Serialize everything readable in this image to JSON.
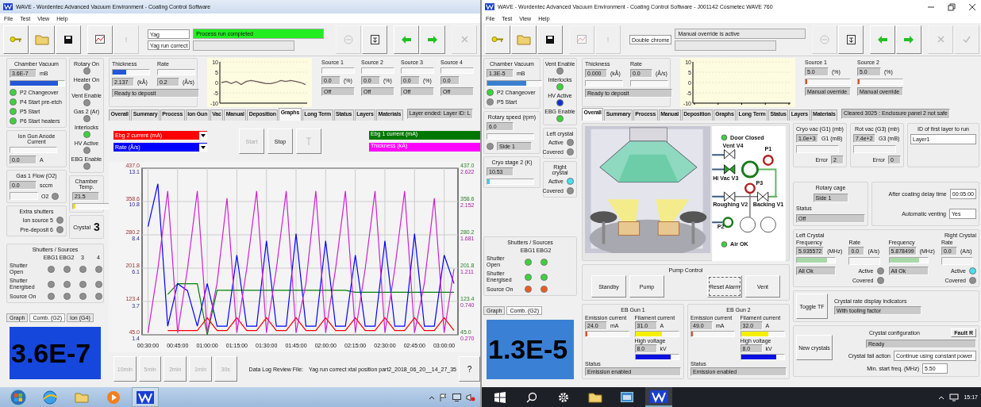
{
  "windows": [
    {
      "title": "WAVE - Wordentec Advanced Vacuum Environment - Coating Control Software",
      "menu": [
        "File",
        "Test",
        "View",
        "Help"
      ],
      "toolbar": [
        {
          "kind": "key",
          "disabled": false
        },
        {
          "kind": "folder",
          "disabled": false
        },
        {
          "kind": "save",
          "disabled": false
        },
        {
          "kind": "chart",
          "disabled": false
        },
        {
          "kind": "text",
          "label": "!",
          "disabled": true
        },
        {
          "kind": "recipe",
          "lines": [
            "Yag",
            "Yag run correct"
          ]
        },
        {
          "kind": "messages",
          "lines": [
            {
              "text": "Process run completed",
              "highlight": true
            }
          ]
        },
        {
          "kind": "circle",
          "disabled": true
        },
        {
          "kind": "doc",
          "disabled": false
        },
        {
          "kind": "back",
          "disabled": false
        },
        {
          "kind": "forward",
          "disabled": false
        },
        {
          "kind": "cross",
          "disabled": true
        }
      ],
      "side": {
        "columns": [
          [
            {
              "title": "Chamber Vacuum",
              "rows": [
                {
                  "kind": "field",
                  "value": "3.6E-7",
                  "unit": "mB"
                },
                {
                  "kind": "bar",
                  "level": 0.88,
                  "color": "#2457d6"
                },
                {
                  "kind": "led",
                  "label": "P2 Changeover",
                  "color": "#3ad43a"
                },
                {
                  "kind": "led",
                  "label": "P4 Start pre-etch",
                  "color": "#3ad43a"
                },
                {
                  "kind": "led",
                  "label": "P5 Start",
                  "color": "#3ad43a"
                },
                {
                  "kind": "led",
                  "label": "P6 Start heaters",
                  "color": "#3ad43a"
                }
              ]
            },
            {
              "title": "Ion Gun Anode Current",
              "rows": [
                {
                  "kind": "bar"
                },
                {
                  "kind": "field",
                  "value": "0.0",
                  "unit": "A"
                }
              ]
            },
            {
              "title": "Gas 1 Flow (O2)",
              "rows": [
                {
                  "kind": "field",
                  "value": "0.0",
                  "unit": "sccm"
                },
                {
                  "kind": "blank-led",
                  "label": "O2",
                  "color": "#8f8f8f"
                }
              ]
            },
            {
              "title": "Extra shutters",
              "rows": [
                {
                  "kind": "labelled-led",
                  "label": "Ion source 5",
                  "color": "#8f8f8f"
                },
                {
                  "kind": "labelled-led",
                  "label": "Pre-deposit 6",
                  "color": "#8f8f8f"
                }
              ]
            }
          ],
          [
            {
              "rows": [
                {
                  "kind": "stacked-led",
                  "label": "Rotary On",
                  "color": "#8f8f8f"
                },
                {
                  "kind": "stacked-led",
                  "label": "Heater On",
                  "color": "#8f8f8f"
                },
                {
                  "kind": "stacked-led",
                  "label": "Vent Enable",
                  "color": "#8f8f8f"
                },
                {
                  "kind": "stacked-led",
                  "label": "Gas 2 (Ar)",
                  "color": "#8f8f8f"
                },
                {
                  "kind": "stacked-led",
                  "label": "Interlocks",
                  "color": "#3ad43a"
                },
                {
                  "kind": "stacked-led",
                  "label": "HV Active",
                  "color": "#8f8f8f"
                },
                {
                  "kind": "stacked-led",
                  "label": "EBG Enable",
                  "color": "#8f8f8f"
                }
              ]
            },
            {
              "title": "Chamber Temp.",
              "rows": [
                {
                  "kind": "field",
                  "value": "21.5"
                },
                {
                  "kind": "bar",
                  "level": 0.06,
                  "color": "#f2e200"
                }
              ]
            },
            {
              "rows": [
                {
                  "kind": "crystal",
                  "label": "Crystal",
                  "value": "3"
                }
              ]
            }
          ]
        ],
        "shutters": {
          "title": "Shutters / Sources",
          "columns": [
            "EBG1",
            "EBG2",
            "3",
            "4"
          ],
          "rows": [
            {
              "label": "Shutter Open",
              "leds": [
                {
                  "color": "#8f8f8f"
                },
                {
                  "color": "#8f8f8f"
                },
                {
                  "color": "#8f8f8f"
                },
                {
                  "color": "#8f8f8f"
                }
              ]
            },
            {
              "label": "Shutter Energised",
              "leds": [
                {
                  "color": "#8f8f8f"
                },
                {
                  "color": "#8f8f8f"
                },
                {
                  "color": "#8f8f8f"
                },
                {
                  "color": "#8f8f8f"
                }
              ]
            },
            {
              "label": "Source On",
              "leds": [
                {
                  "color": "#8f8f8f"
                },
                {
                  "color": "#8f8f8f"
                },
                {
                  "color": "#8f8f8f"
                },
                {
                  "color": "#8f8f8f"
                }
              ]
            }
          ]
        },
        "display": {
          "tabs": [
            {
              "label": "Graph",
              "selected": false
            },
            {
              "label": "Comb. (G2)",
              "selected": true
            },
            {
              "label": "Ion (G4)",
              "selected": false
            }
          ],
          "value": "3.6E-7",
          "color": "#1547dc"
        }
      },
      "main": {
        "deposition": {
          "thickness": {
            "label": "Thickness",
            "value": "2.137",
            "unit": "(kÅ)",
            "level": 0.36
          },
          "rate": {
            "label": "Rate",
            "value": "0.2",
            "unit": "(Å/s)"
          },
          "status": "Ready to deposit"
        },
        "mini_chart": {
          "chart_data": {
            "type": "line",
            "grid": true,
            "ylim": [
              -10,
              10
            ],
            "yticks": [
              10,
              5,
              0,
              -5,
              -10
            ],
            "series": [
              {
                "color": "#6a5a5a",
                "values": [
                  0,
                  0.5,
                  -0.5,
                  0.5,
                  -1,
                  0.5,
                  1,
                  0.5,
                  0,
                  -0.5,
                  -0.5,
                  0,
                  1,
                  0.5,
                  1,
                  0.5,
                  0,
                  -1
                ]
              }
            ]
          }
        },
        "sources": [
          {
            "label": "Source 1",
            "value": "0.0",
            "unit": "(%)",
            "mode": "Off"
          },
          {
            "label": "Source 2",
            "value": "0.0",
            "unit": "(%)",
            "mode": "Off"
          },
          {
            "label": "Source 3",
            "value": "0.0",
            "unit": "(%)",
            "mode": "Off"
          },
          {
            "label": "Source 4",
            "value": "0.0",
            "mode": "Off"
          }
        ],
        "tabs": [
          {
            "label": "Overall",
            "selected": false
          },
          {
            "label": "Summary",
            "selected": false
          },
          {
            "label": "Process",
            "selected": false
          },
          {
            "label": "Ion Gun",
            "selected": false
          },
          {
            "label": "Vac",
            "selected": false
          },
          {
            "label": "Manual",
            "selected": false
          },
          {
            "label": "Deposition",
            "selected": false
          },
          {
            "label": "Graphs",
            "selected": true
          },
          {
            "label": "Long Term",
            "selected": false
          },
          {
            "label": "Status",
            "selected": false
          },
          {
            "label": "Layers",
            "selected": false
          },
          {
            "label": "Materials",
            "selected": false
          }
        ],
        "tab_message": "Layer ended: Layer ID: L",
        "graphs": {
          "selectors": [
            {
              "kind": "dropdown",
              "label": "Ebg 2 current (mA)",
              "color": "#ff0000"
            },
            {
              "kind": "dropdown",
              "label": "Rate (Å/s)",
              "color": "#0000ff"
            },
            {
              "kind": "swatch",
              "label": "Ebg 1 current (mA)",
              "color": "#007800"
            },
            {
              "kind": "swatch",
              "label": "Thickness (kÅ)",
              "color": "#ff00ff"
            }
          ],
          "buttons": [
            {
              "kind": "text",
              "label": "Start",
              "disabled": true
            },
            {
              "kind": "text",
              "label": "Stop",
              "disabled": false
            },
            {
              "kind": "icon",
              "disabled": true
            }
          ],
          "chart_data": {
            "type": "line",
            "grid": true,
            "x": [
              30,
              35,
              40,
              45,
              50,
              55,
              60,
              65,
              70,
              75,
              80,
              85,
              90,
              95,
              100,
              105,
              110,
              115,
              120,
              125,
              130,
              135,
              140,
              145,
              150,
              155,
              160,
              165,
              170,
              175,
              180,
              185
            ],
            "xlim": [
              27,
              187
            ],
            "ylim": [
              45,
              437
            ],
            "y2lim": [
              1.4,
              13.1
            ],
            "y3lim": [
              0.27,
              2.622
            ],
            "xticks": [
              {
                "value": 30,
                "label": "00:30:00"
              },
              {
                "value": 45,
                "label": "00:45:00"
              },
              {
                "value": 60,
                "label": "01:00:00"
              },
              {
                "value": 75,
                "label": "01:15:00"
              },
              {
                "value": 90,
                "label": "01:30:00"
              },
              {
                "value": 105,
                "label": "01:45:00"
              },
              {
                "value": 120,
                "label": "02:00:00"
              },
              {
                "value": 135,
                "label": "02:15:00"
              },
              {
                "value": 150,
                "label": "02:30:00"
              },
              {
                "value": 165,
                "label": "02:45:00"
              },
              {
                "value": 180,
                "label": "03:00:00"
              }
            ],
            "yticks": [
              {
                "value": 437,
                "label": "437.0"
              },
              {
                "value": 358.6,
                "label": "358.6"
              },
              {
                "value": 280.2,
                "label": "280.2"
              },
              {
                "value": 201.8,
                "label": "201.8"
              },
              {
                "value": 123.4,
                "label": "123.4"
              },
              {
                "value": 45,
                "label": "45.0"
              }
            ],
            "y2ticks": [
              {
                "value": 13.1,
                "label": "13.1"
              },
              {
                "value": 10.8,
                "label": "10.8"
              },
              {
                "value": 8.4,
                "label": "8.4"
              },
              {
                "value": 6.1,
                "label": "6.1"
              },
              {
                "value": 3.7,
                "label": "3.7"
              },
              {
                "value": 1.4,
                "label": "1.4"
              }
            ],
            "y3ticks": [
              {
                "value": 2.622,
                "label": "2.622"
              },
              {
                "value": 2.152,
                "label": "2.152"
              },
              {
                "value": 1.681,
                "label": "1.681"
              },
              {
                "value": 1.211,
                "label": "1.211"
              },
              {
                "value": 0.74,
                "label": "0.740"
              },
              {
                "value": 0.27,
                "label": "0.270"
              }
            ],
            "series": [
              {
                "color": "#008000",
                "values": [
                  null,
                  null,
                  140,
                  165,
                  165,
                  165,
                  45,
                  150,
                  150,
                  150,
                  150,
                  150,
                  150,
                  150,
                  150,
                  150,
                  150,
                  150,
                  150,
                  150,
                  150,
                  145,
                  145,
                  145,
                  145,
                  145,
                  145,
                  145,
                  145,
                  145,
                  145,
                  145
                ]
              },
              {
                "color": "#ff0000",
                "values": [
                  null,
                  null,
                  55,
                  55,
                  55,
                  55,
                  85,
                  55,
                  55,
                  85,
                  55,
                  55,
                  85,
                  55,
                  55,
                  85,
                  55,
                  55,
                  85,
                  55,
                  55,
                  85,
                  55,
                  55,
                  85,
                  55,
                  55,
                  85,
                  55,
                  55,
                  85,
                  55
                ]
              },
              {
                "color": "#0000ff",
                "axis": "y2",
                "values": [
                  9,
                  12,
                  2,
                  5,
                  4.5,
                  2,
                  5,
                  2,
                  2,
                  7,
                  2,
                  2,
                  8,
                  2,
                  2,
                  8.5,
                  2,
                  2,
                  8,
                  2,
                  2,
                  7,
                  2,
                  2,
                  8,
                  2,
                  2,
                  8.5,
                  2,
                  2,
                  7,
                  5
                ]
              },
              {
                "color": "#d020d0",
                "axis": "y3",
                "values": [
                  0.3,
                  1.2,
                  2.3,
                  0.3,
                  1.2,
                  2.3,
                  0.3,
                  1,
                  2.2,
                  0.3,
                  1.2,
                  2.3,
                  0.3,
                  1.2,
                  2.3,
                  0.3,
                  1,
                  2.3,
                  0.3,
                  1.2,
                  2.3,
                  0.3,
                  1.2,
                  2.3,
                  0.3,
                  1.2,
                  2.3,
                  0.3,
                  1,
                  2.2,
                  0.3,
                  1.2
                ]
              }
            ]
          },
          "right_axis_labels": [
            "437.0",
            "358.6",
            "280.2",
            "201.8",
            "123.4",
            "45.0"
          ],
          "zoom_buttons": [
            {
              "label": "10min",
              "disabled": true
            },
            {
              "label": "5min",
              "disabled": true
            },
            {
              "label": "2min",
              "disabled": true
            },
            {
              "label": "1min",
              "disabled": true
            },
            {
              "label": "30s",
              "disabled": true
            }
          ],
          "log_label": "Data Log Review File:",
          "log_file": "Yag run correct xtal position part2_2018_06_20__14_27_35",
          "help": "?"
        }
      },
      "taskbar": {
        "apps": [
          {
            "kind": "start",
            "selected": false
          },
          {
            "kind": "browser",
            "selected": false
          },
          {
            "kind": "folder",
            "selected": false
          },
          {
            "kind": "media",
            "selected": false
          },
          {
            "kind": "wave",
            "selected": true
          }
        ],
        "tray": [
          {
            "kind": "caret"
          },
          {
            "kind": "flag"
          },
          {
            "kind": "monitor"
          },
          {
            "kind": "muted"
          }
        ]
      }
    },
    {
      "title": "WAVE - Wordentec Advanced Vacuum Environment - Coating Control Software - J001142 Cosmetec WAVE 760",
      "menu": [
        "File",
        "Test",
        "View",
        "Help"
      ],
      "toolbar": [
        {
          "kind": "key",
          "disabled": false
        },
        {
          "kind": "folder",
          "disabled": false
        },
        {
          "kind": "save",
          "disabled": false
        },
        {
          "kind": "chart",
          "disabled": true
        },
        {
          "kind": "text",
          "label": "!",
          "disabled": true
        },
        {
          "kind": "recipe",
          "lines": [
            "Double chrome"
          ]
        },
        {
          "kind": "messages",
          "lines": [
            {
              "text": "Manual override is active",
              "highlight": false
            }
          ]
        },
        {
          "kind": "circle",
          "disabled": true
        },
        {
          "kind": "doc",
          "disabled": false
        },
        {
          "kind": "back",
          "disabled": false
        },
        {
          "kind": "forward",
          "disabled": false
        },
        {
          "kind": "cross",
          "disabled": true
        },
        {
          "kind": "check",
          "disabled": true
        }
      ],
      "side": {
        "columns": [
          [
            {
              "title": "Chamber Vacuum",
              "rows": [
                {
                  "kind": "field",
                  "value": "1.3E-5",
                  "unit": "mB"
                },
                {
                  "kind": "bar",
                  "level": 0.72,
                  "color": "#3a7fd0"
                },
                {
                  "kind": "led",
                  "label": "P2 Changeover",
                  "color": "#3ad43a"
                },
                {
                  "kind": "led",
                  "label": "P5 Start",
                  "color": "#8f8f8f"
                }
              ]
            },
            {
              "title": "Rotary speed (rpm)",
              "rows": [
                {
                  "kind": "field",
                  "value": "6.0"
                },
                {
                  "kind": "bar"
                },
                {
                  "kind": "led-field",
                  "value": "Side 1",
                  "color": "#8f8f8f"
                }
              ]
            },
            {
              "title": "Cryo stage 2 (K)",
              "rows": [
                {
                  "kind": "field",
                  "value": "10.53"
                },
                {
                  "kind": "bar",
                  "level": 0.06,
                  "color": "#35d0e0"
                }
              ]
            }
          ],
          [
            {
              "rows": [
                {
                  "kind": "stacked-led",
                  "label": "Vent Enable",
                  "color": "#8f8f8f"
                },
                {
                  "kind": "stacked-led",
                  "label": "Interlocks",
                  "color": "#3ad43a"
                },
                {
                  "kind": "stacked-led",
                  "label": "HV Active",
                  "color": "#1030d0"
                },
                {
                  "kind": "stacked-led",
                  "label": "EBG Enable",
                  "color": "#3ad43a"
                }
              ]
            },
            {
              "title": "Left crystal",
              "rows": [
                {
                  "kind": "labelled-led",
                  "label": "Active",
                  "color": "#8f8f8f"
                },
                {
                  "kind": "labelled-led",
                  "label": "Covered",
                  "color": "#8f8f8f"
                }
              ]
            },
            {
              "title": "Right crystal",
              "rows": [
                {
                  "kind": "labelled-led",
                  "label": "Active",
                  "color": "#45e0f0"
                },
                {
                  "kind": "labelled-led",
                  "label": "Covered",
                  "color": "#8f8f8f"
                }
              ]
            }
          ]
        ],
        "shutters": {
          "title": "Shutters / Sources",
          "columns": [
            "EBG1",
            "EBG2"
          ],
          "rows": [
            {
              "label": "Shutter Open",
              "leds": [
                {
                  "color": "#3ad43a"
                },
                {
                  "color": "#3ad43a"
                }
              ]
            },
            {
              "label": "Shutter Energised",
              "leds": [
                {
                  "color": "#3ad43a"
                },
                {
                  "color": "#3ad43a"
                }
              ]
            },
            {
              "label": "Source On",
              "leds": [
                {
                  "color": "#f05a1e"
                },
                {
                  "color": "#f05a1e"
                }
              ]
            }
          ]
        },
        "display": {
          "tabs": [
            {
              "label": "Graph",
              "selected": false
            },
            {
              "label": "Comb. (G2)",
              "selected": true
            }
          ],
          "value": "1.3E-5",
          "color": "#3a80d4"
        }
      },
      "main": {
        "deposition": {
          "thickness": {
            "label": "Thickness",
            "value": "0.000",
            "unit": "(kÅ)"
          },
          "rate": {
            "label": "Rate",
            "value": "0.0",
            "unit": "(Å/s)"
          },
          "status": "Ready to deposit"
        },
        "mini_chart": {
          "chart_data": {
            "type": "line",
            "grid": true,
            "categories": [
              null,
              null,
              null,
              null,
              null
            ],
            "ylim": [
              -10,
              10
            ],
            "yticks": [
              10,
              5,
              0,
              -5,
              -10
            ]
          }
        },
        "sources": [
          {
            "label": "Source 1",
            "level": 0.04,
            "value": "5.0",
            "unit": "(%)",
            "mode": "Manual override"
          },
          {
            "label": "Source 2",
            "level": 0.04,
            "value": "5.0",
            "unit": "(%)",
            "mode": "Manual override"
          }
        ],
        "tabs": [
          {
            "label": "Overall",
            "selected": true
          },
          {
            "label": "Summary",
            "selected": false
          },
          {
            "label": "Process",
            "selected": false
          },
          {
            "label": "Manual",
            "selected": false
          },
          {
            "label": "Deposition",
            "selected": false
          },
          {
            "label": "Graphs",
            "selected": false
          },
          {
            "label": "Long Term",
            "selected": false
          },
          {
            "label": "Status",
            "selected": false
          },
          {
            "label": "Layers",
            "selected": false
          },
          {
            "label": "Materials",
            "selected": false
          }
        ],
        "tab_message": "Cleared 3025 : Enclosure panel 2 not safe",
        "overview": {
          "schematic": {
            "door": {
              "label": "Door Closed",
              "color": "#3ad43a"
            },
            "air": {
              "label": "Air OK",
              "color": "#3ad43a"
            },
            "valves": [
              {
                "label": "Vent V4",
                "open": false
              },
              {
                "label": "Hi Vac V3",
                "open": true
              },
              {
                "label": "Roughing V2",
                "open": false
              },
              {
                "label": "Backing V1",
                "open": false
              }
            ],
            "gauges": [
              {
                "label": "P1"
              },
              {
                "label": "P3"
              },
              {
                "label": "P2"
              }
            ]
          },
          "pump_control": {
            "title": "Pump Control",
            "buttons": [
              {
                "label": "Standby",
                "focused": false
              },
              {
                "label": "Pump",
                "focused": false
              },
              {
                "label": "Reset Alarm",
                "focused": true
              },
              {
                "label": "Vent",
                "focused": false
              }
            ]
          },
          "eb_guns": [
            {
              "title": "EB Gun 1",
              "emission": {
                "label": "Emission current",
                "value": "24.0",
                "unit": "mA",
                "level": 0.03
              },
              "filament": {
                "label": "Filament current",
                "value": "31.0",
                "unit": "A",
                "level": 0.62
              },
              "hv": {
                "label": "High voltage",
                "value": "8.0",
                "unit": "kV",
                "level": 0.82
              },
              "status_label": "Status",
              "status": "Emission enabled"
            },
            {
              "title": "EB Gun 2",
              "emission": {
                "label": "Emission current",
                "value": "49.0",
                "unit": "mA",
                "level": 0.04
              },
              "filament": {
                "label": "Filament current",
                "value": "32.0",
                "unit": "A",
                "level": 0.64
              },
              "hv": {
                "label": "High voltage",
                "value": "8.0",
                "unit": "kV",
                "level": 0.82
              },
              "status_label": "Status",
              "status": "Emission enabled"
            }
          ],
          "gauges": [
            {
              "title": "Cryo vac (G1) (mb)",
              "value": "1.0e+3",
              "unit": "G1 (mB)",
              "error_label": "Error",
              "error": "2"
            },
            {
              "title": "Rot vac (G3) (mb)",
              "value": "7.4e+2",
              "unit": "G3 (mB)",
              "error_label": "Error",
              "error": "0"
            }
          ],
          "first_layer": {
            "label": "ID of first layer to run",
            "value": "Layer1"
          },
          "rotary_cage": {
            "title": "Rotary cage",
            "value": "Side 1",
            "status_label": "Status",
            "status": "Off"
          },
          "venting": {
            "delay_label": "After coating delay time",
            "delay": "00:05:00",
            "auto_label": "Automatic venting",
            "auto": "Yes"
          },
          "crystals": [
            {
              "title": "Left Crystal",
              "freq_label": "Frequency",
              "freq": "5.935572",
              "freq_unit": "(MHz)",
              "level": 0.8,
              "rate_label": "Rate",
              "rate": "0.0",
              "rate_unit": "(A/s)",
              "status": "All Ok",
              "active": {
                "label": "Active",
                "color": "#8f8f8f"
              },
              "covered": {
                "label": "Covered",
                "color": "#8f8f8f"
              }
            },
            {
              "title": "Right Crystal",
              "freq_label": "Frequency",
              "freq": "5.878499",
              "freq_unit": "(MHz)",
              "level": 0.78,
              "rate_label": "Rate",
              "rate": "0.0",
              "rate_unit": "(A/s)",
              "status": "All Ok",
              "active": {
                "label": "Active",
                "color": "#45e0f0"
              },
              "covered": {
                "label": "Covered",
                "color": "#8f8f8f"
              }
            }
          ],
          "tooling": {
            "button": "Toggle TF",
            "label": "Crystal rate display indicators",
            "value": "With tooling factor"
          },
          "crystal_config": {
            "button": "New crystals",
            "label": "Crystal configuration",
            "value": "Ready",
            "fault_button": "Fault R",
            "fail_label": "Crystal fail action",
            "fail_value": "Continue using constant power",
            "min_label": "Min. start freq. (MHz)",
            "min_value": "5.50"
          }
        }
      },
      "taskbar": {
        "apps": [
          {
            "kind": "windows",
            "selected": false
          },
          {
            "kind": "search",
            "selected": false
          },
          {
            "kind": "gear",
            "selected": false
          },
          {
            "kind": "folder",
            "selected": false
          },
          {
            "kind": "window",
            "selected": false
          },
          {
            "kind": "wave",
            "selected": true
          }
        ],
        "tray": [
          {
            "kind": "caret"
          },
          {
            "kind": "network"
          }
        ],
        "clock": "15:17"
      }
    }
  ]
}
